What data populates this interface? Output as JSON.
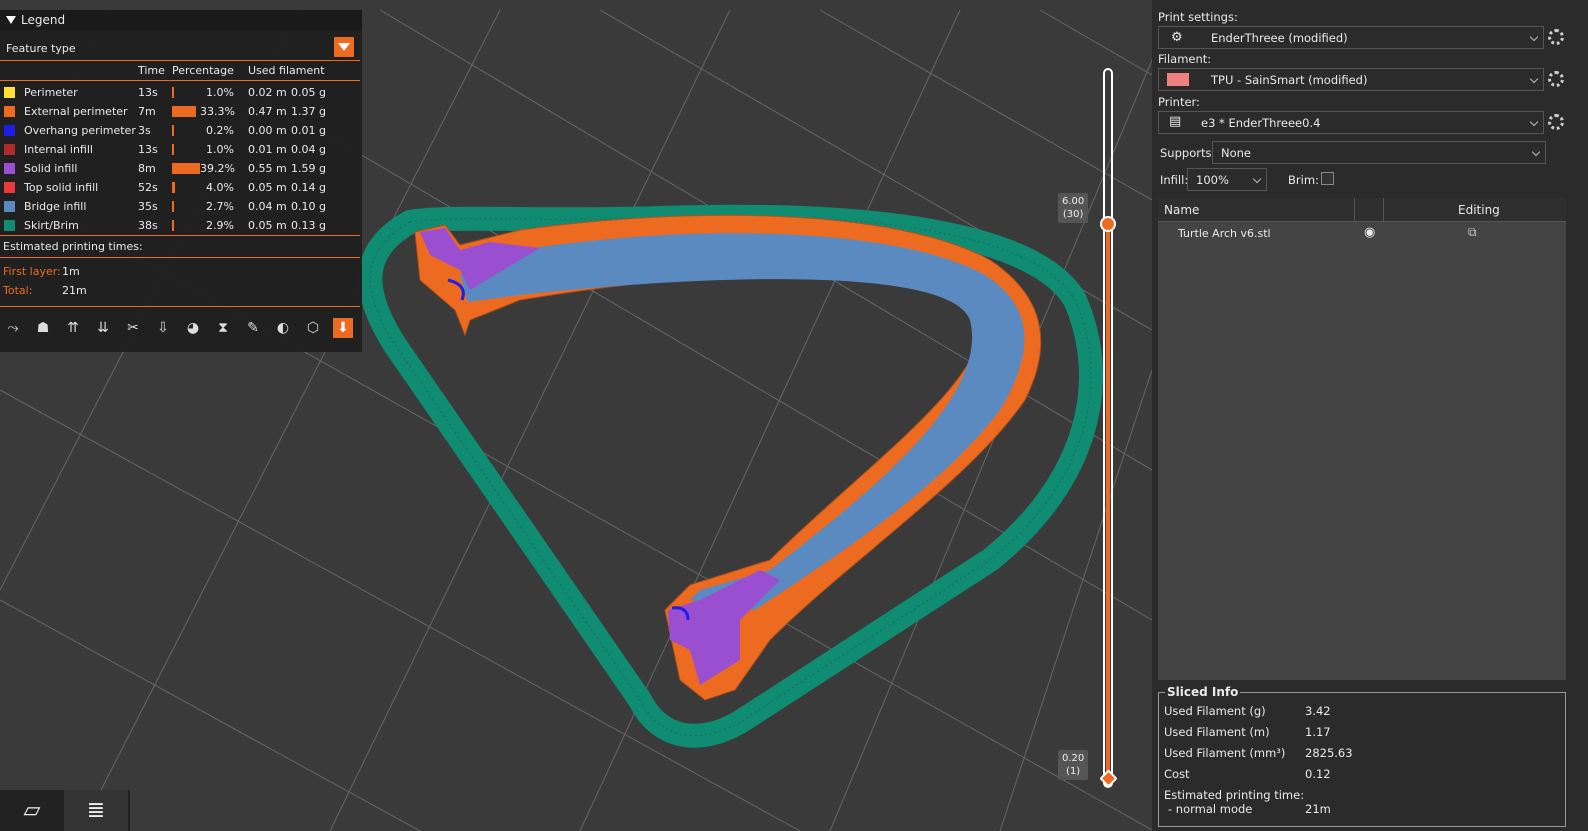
{
  "legend": {
    "title": "Legend",
    "feature_type_label": "Feature type",
    "columns": {
      "time": "Time",
      "percentage": "Percentage",
      "used_filament": "Used filament"
    },
    "rows": [
      {
        "name": "Perimeter",
        "color": "#FFE033",
        "time": "13s",
        "percentage": "1.0%",
        "pct_value": 1.0,
        "length": "0.02 m",
        "weight": "0.05 g"
      },
      {
        "name": "External perimeter",
        "color": "#ED6B21",
        "time": "7m",
        "percentage": "33.3%",
        "pct_value": 33.3,
        "length": "0.47 m",
        "weight": "1.37 g"
      },
      {
        "name": "Overhang perimeter",
        "color": "#1E1EE6",
        "time": "3s",
        "percentage": "0.2%",
        "pct_value": 0.2,
        "length": "0.00 m",
        "weight": "0.01 g"
      },
      {
        "name": "Internal infill",
        "color": "#B02A2A",
        "time": "13s",
        "percentage": "1.0%",
        "pct_value": 1.0,
        "length": "0.01 m",
        "weight": "0.04 g"
      },
      {
        "name": "Solid infill",
        "color": "#9A4FD0",
        "time": "8m",
        "percentage": "39.2%",
        "pct_value": 39.2,
        "length": "0.55 m",
        "weight": "1.59 g"
      },
      {
        "name": "Top solid infill",
        "color": "#E83A3A",
        "time": "52s",
        "percentage": "4.0%",
        "pct_value": 4.0,
        "length": "0.05 m",
        "weight": "0.14 g"
      },
      {
        "name": "Bridge infill",
        "color": "#5A8AC0",
        "time": "35s",
        "percentage": "2.7%",
        "pct_value": 2.7,
        "length": "0.04 m",
        "weight": "0.10 g"
      },
      {
        "name": "Skirt/Brim",
        "color": "#0F8C72",
        "time": "38s",
        "percentage": "2.9%",
        "pct_value": 2.9,
        "length": "0.05 m",
        "weight": "0.13 g"
      }
    ],
    "estimated_label": "Estimated printing times:",
    "first_layer_label": "First layer:",
    "first_layer_value": "1m",
    "total_label": "Total:",
    "total_value": "21m"
  },
  "slider": {
    "top_value": "6.00",
    "top_layer": "(30)",
    "bottom_value": "0.20",
    "bottom_layer": "(1)",
    "top_fraction": 1.0,
    "bottom_fraction": 0.0
  },
  "sidebar": {
    "print_settings_label": "Print settings:",
    "print_settings_value": "EnderThreee (modified)",
    "filament_label": "Filament:",
    "filament_value": "TPU - SainSmart (modified)",
    "filament_color": "#F08080",
    "printer_label": "Printer:",
    "printer_value": "e3 * EnderThreee0.4",
    "supports_label": "Supports:",
    "supports_value": "None",
    "infill_label": "Infill:",
    "infill_value": "100%",
    "brim_label": "Brim:",
    "brim_checked": false,
    "object_list": {
      "col_name": "Name",
      "col_editing": "Editing",
      "objects": [
        {
          "name": "Turtle Arch v6.stl"
        }
      ]
    },
    "sliced_info": {
      "title": "Sliced Info",
      "used_filament_g_label": "Used Filament (g)",
      "used_filament_g": "3.42",
      "used_filament_m_label": "Used Filament (m)",
      "used_filament_m": "1.17",
      "used_filament_mm3_label": "Used Filament (mm³)",
      "used_filament_mm3": "2825.63",
      "cost_label": "Cost",
      "cost": "0.12",
      "est_time_label": "Estimated printing time:",
      "normal_mode_label": "- normal mode",
      "normal_mode_value": "21m"
    }
  },
  "colors": {
    "accent": "#ED6B21",
    "skirt": "#0F8C72",
    "bridge": "#5A8AC0",
    "solid": "#9A4FD0"
  }
}
